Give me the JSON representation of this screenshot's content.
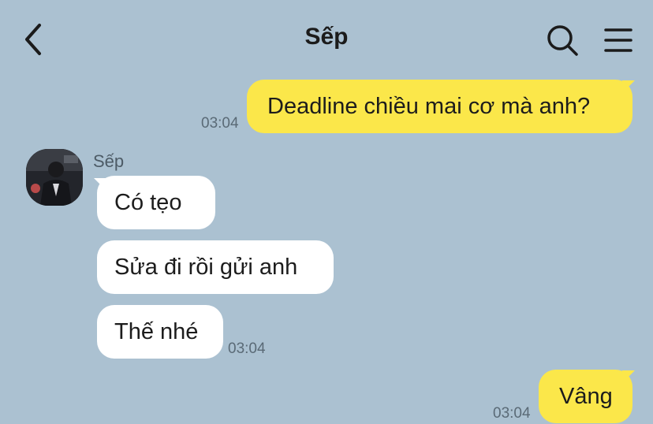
{
  "header": {
    "title": "Sếp",
    "back_icon": "chevron-left-icon",
    "search_icon": "search-icon",
    "menu_icon": "hamburger-menu-icon"
  },
  "colors": {
    "background": "#abc1d1",
    "outgoing_bubble": "#fbe74a",
    "incoming_bubble": "#ffffff",
    "timestamp": "#5a6a76"
  },
  "messages": [
    {
      "direction": "outgoing",
      "text": "Deadline chiều mai cơ mà anh?",
      "time": "03:04"
    },
    {
      "direction": "incoming",
      "sender": "Sếp",
      "text": "Có tẹo"
    },
    {
      "direction": "incoming",
      "text": "Sửa đi rồi gửi anh"
    },
    {
      "direction": "incoming",
      "text": "Thế nhé",
      "time": "03:04"
    },
    {
      "direction": "outgoing",
      "text": "Vâng",
      "time": "03:04"
    }
  ]
}
